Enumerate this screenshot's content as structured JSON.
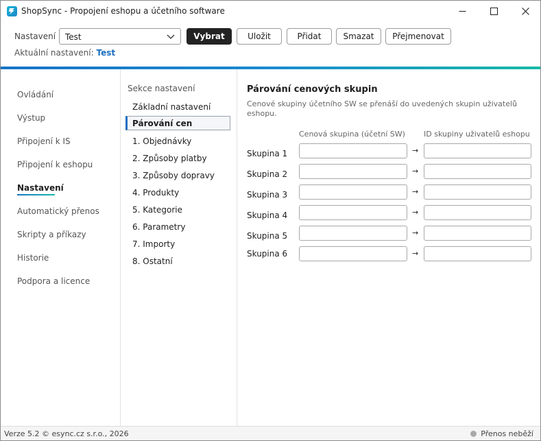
{
  "window": {
    "title": "ShopSync - Propojení eshopu a účetního software"
  },
  "toolbar": {
    "settings_label": "Nastavení",
    "selected_setting": "Test",
    "buttons": {
      "select": "Vybrat",
      "save": "Uložit",
      "add": "Přidat",
      "delete": "Smazat",
      "rename": "Přejmenovat"
    },
    "current_label": "Aktuální nastavení:",
    "current_value": "Test"
  },
  "nav": {
    "items": [
      {
        "label": "Ovládání"
      },
      {
        "label": "Výstup"
      },
      {
        "label": "Připojení k IS"
      },
      {
        "label": "Připojení k eshopu"
      },
      {
        "label": "Nastavení",
        "active": true
      },
      {
        "label": "Automatický přenos"
      },
      {
        "label": "Skripty a příkazy"
      },
      {
        "label": "Historie"
      },
      {
        "label": "Podpora a licence"
      }
    ]
  },
  "sections": {
    "heading": "Sekce nastavení",
    "items": [
      {
        "label": "Základní nastavení"
      },
      {
        "label": "Párování cen",
        "active": true
      },
      {
        "label": "1. Objednávky"
      },
      {
        "label": "2. Způsoby platby"
      },
      {
        "label": "3. Způsoby dopravy"
      },
      {
        "label": "4. Produkty"
      },
      {
        "label": "5. Kategorie"
      },
      {
        "label": "6. Parametry"
      },
      {
        "label": "7. Importy"
      },
      {
        "label": "8. Ostatní"
      }
    ]
  },
  "main": {
    "title": "Párování cenových skupin",
    "description": "Cenové skupiny účetního SW se přenáší do uvedených skupin uživatelů eshopu.",
    "col_left": "Cenová skupina (účetní SW)",
    "col_right": "ID skupiny uživatelů eshopu",
    "arrow": "→",
    "rows": [
      {
        "label": "Skupina 1",
        "left_value": "",
        "right_value": ""
      },
      {
        "label": "Skupina 2",
        "left_value": "",
        "right_value": ""
      },
      {
        "label": "Skupina 3",
        "left_value": "",
        "right_value": ""
      },
      {
        "label": "Skupina 4",
        "left_value": "",
        "right_value": ""
      },
      {
        "label": "Skupina 5",
        "left_value": "",
        "right_value": ""
      },
      {
        "label": "Skupina 6",
        "left_value": "",
        "right_value": ""
      }
    ]
  },
  "status": {
    "left": "Verze 5.2  © esync.cz s.r.o., 2026",
    "right": "Přenos neběží"
  },
  "icons": {
    "app": "app-logo-icon",
    "minimize": "minimize-icon",
    "maximize": "maximize-icon",
    "close": "close-icon",
    "chevron": "chevron-down-icon",
    "status": "status-dot-icon"
  },
  "colors": {
    "accent": "#1a6fc0",
    "primary_button": "#232323",
    "gradient_end": "#16b9a6"
  }
}
